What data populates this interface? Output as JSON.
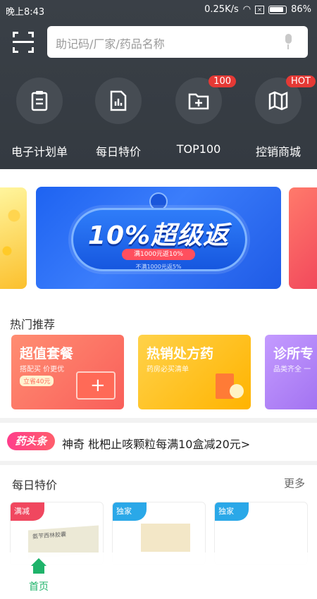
{
  "status_bar": {
    "time": "晚上8:43",
    "network_speed": "0.25K/s",
    "battery": "86%"
  },
  "search": {
    "placeholder": "助记码/厂家/药品名称"
  },
  "quick_links": [
    {
      "label": "电子计划单",
      "icon": "clipboard-icon",
      "badge": ""
    },
    {
      "label": "每日特价",
      "icon": "document-chart-icon",
      "badge": ""
    },
    {
      "label": "TOP100",
      "icon": "folder-plus-icon",
      "badge": "100"
    },
    {
      "label": "控销商城",
      "icon": "map-icon",
      "badge": "HOT"
    }
  ],
  "banner": {
    "title": "10%超级返",
    "subtitle": "满1000元返10%",
    "note": "不满1000元返5%"
  },
  "hot_section": {
    "title": "热门推荐",
    "cards": [
      {
        "title": "超值套餐",
        "subtitle": "搭配买 价更优",
        "tag": "立省40元"
      },
      {
        "title": "热销处方药",
        "subtitle": "药房必买清单"
      },
      {
        "title": "诊所专",
        "subtitle": "品类齐全 一"
      }
    ]
  },
  "headline": {
    "badge": "药头条",
    "text": "神奇 枇杷止咳颗粒每满10盒减20元>"
  },
  "daily_special": {
    "title": "每日特价",
    "more": "更多",
    "products": [
      {
        "corner_tag": "满减",
        "name_text": "氨苄西林胶囊"
      },
      {
        "corner_tag": "独家"
      },
      {
        "corner_tag": "独家"
      }
    ]
  },
  "bottom_nav": {
    "home_label": "首页"
  },
  "colors": {
    "header_bg": "#3a4047",
    "accent_green": "#1fb36a",
    "badge_red": "#e53935"
  }
}
